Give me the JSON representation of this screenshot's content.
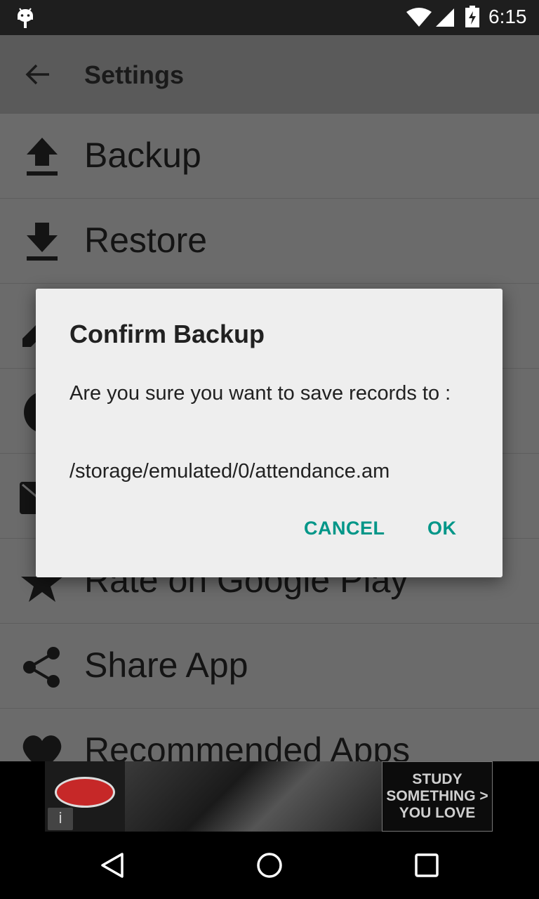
{
  "status_bar": {
    "time": "6:15",
    "icons": [
      "android-icon",
      "wifi-icon",
      "signal-icon",
      "battery-icon"
    ]
  },
  "app_bar": {
    "title": "Settings",
    "back_icon": "arrow-back-icon"
  },
  "settings_list": {
    "items": [
      {
        "label": "Backup",
        "icon": "upload-icon"
      },
      {
        "label": "Restore",
        "icon": "download-icon"
      },
      {
        "label": "",
        "icon": "edit-icon"
      },
      {
        "label": "",
        "icon": "circle-icon"
      },
      {
        "label": "",
        "icon": "mail-icon"
      },
      {
        "label": "Rate on Google Play",
        "icon": "star-icon"
      },
      {
        "label": "Share App",
        "icon": "share-icon"
      },
      {
        "label": "Recommended Apps",
        "icon": "heart-icon"
      }
    ]
  },
  "dialog": {
    "title": "Confirm Backup",
    "message": "Are you sure you want to save records to :",
    "path": "/storage/emulated/0/attendance.am",
    "cancel_label": "CANCEL",
    "ok_label": "OK"
  },
  "ad_banner": {
    "cta_line1": "STUDY",
    "cta_line2": "SOMETHING >",
    "cta_line3": "YOU LOVE",
    "info_icon": "i"
  },
  "colors": {
    "accent": "#009688",
    "dialog_bg": "#eeeeee",
    "dimmed_list": "#6b6b6b",
    "app_bar_dimmed": "#5a5a5a",
    "status_bar": "#1e1e1e"
  }
}
